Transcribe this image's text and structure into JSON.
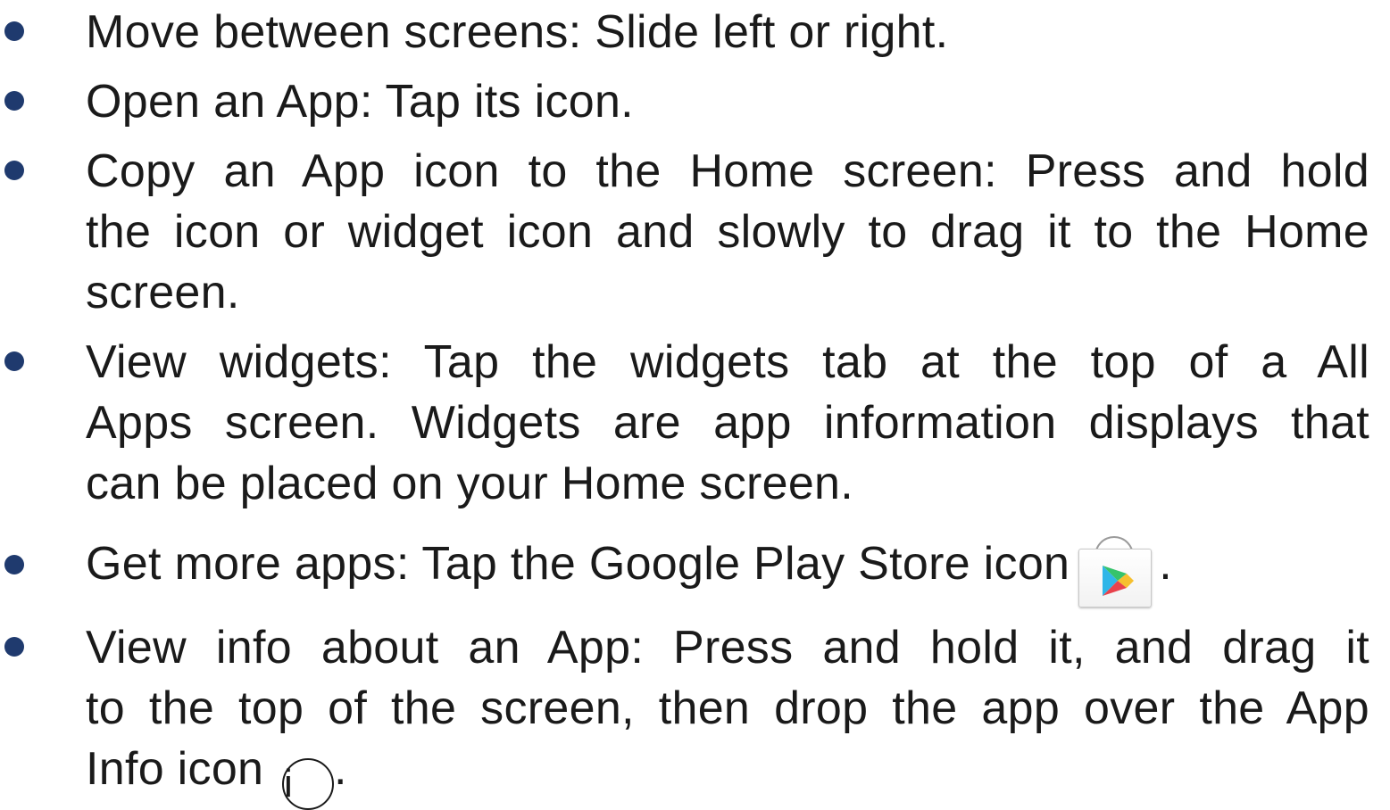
{
  "bullets": [
    {
      "lines": [
        "Move between screens: Slide left or right."
      ]
    },
    {
      "lines": [
        "Open an App: Tap its icon."
      ]
    },
    {
      "lines": [
        "Copy an App icon to the Home screen: Press and hold",
        "the icon or widget icon and slowly to drag it to the Home",
        "screen."
      ]
    },
    {
      "lines": [
        "View widgets: Tap the widgets tab at the top of a All",
        "Apps screen. Widgets are app information displays that",
        "can be placed on your Home screen."
      ]
    },
    {
      "lines_prefix": "Get more apps: Tap the Google Play Store icon",
      "lines_suffix": "."
    },
    {
      "lines": [
        "View info about an App: Press and hold it, and drag it",
        "to the top of the screen, then drop the app over the App"
      ],
      "last_prefix": "Info icon",
      "last_suffix": "."
    }
  ],
  "icons": {
    "play_store": "google-play-store-icon",
    "info": "info-icon",
    "info_glyph": "i"
  },
  "colors": {
    "bullet": "#1f3a6e",
    "text": "#1a1a1a"
  }
}
